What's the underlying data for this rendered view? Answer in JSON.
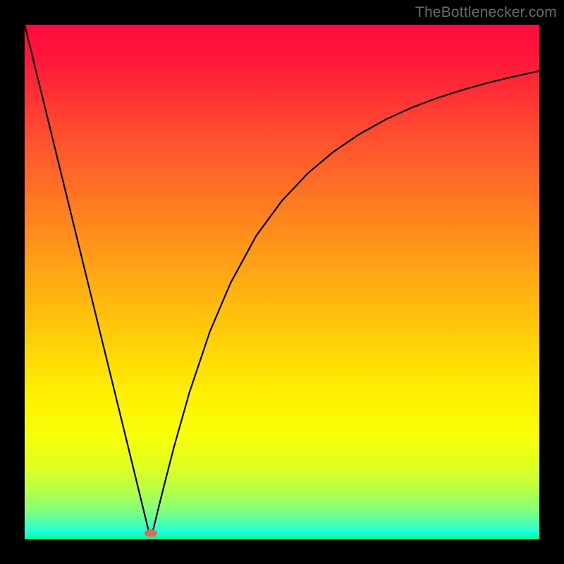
{
  "watermark": "TheBottlenecker.com",
  "chart_data": {
    "type": "line",
    "title": "",
    "xlabel": "",
    "ylabel": "",
    "xlim": [
      0,
      100
    ],
    "ylim": [
      0,
      100
    ],
    "grid": false,
    "background_gradient": {
      "stops": [
        {
          "offset": 0.0,
          "color": "#ff093e"
        },
        {
          "offset": 0.08,
          "color": "#ff1b3a"
        },
        {
          "offset": 0.2,
          "color": "#ff4930"
        },
        {
          "offset": 0.35,
          "color": "#ff7b22"
        },
        {
          "offset": 0.5,
          "color": "#ffac13"
        },
        {
          "offset": 0.62,
          "color": "#ffd208"
        },
        {
          "offset": 0.72,
          "color": "#fff000"
        },
        {
          "offset": 0.8,
          "color": "#f8ff08"
        },
        {
          "offset": 0.86,
          "color": "#deff22"
        },
        {
          "offset": 0.905,
          "color": "#b6ff48"
        },
        {
          "offset": 0.94,
          "color": "#87ff78"
        },
        {
          "offset": 0.965,
          "color": "#54ffab"
        },
        {
          "offset": 0.985,
          "color": "#20ffdf"
        },
        {
          "offset": 1.0,
          "color": "#00ff89"
        }
      ]
    },
    "marker": {
      "x": 24.5,
      "y": 1.2,
      "color": "#d66b5a"
    },
    "series": [
      {
        "name": "curve",
        "color": "#000000",
        "x": [
          0,
          5,
          10,
          15,
          20,
          22,
          23,
          24,
          24.5,
          25,
          26,
          27,
          29,
          32,
          36,
          40,
          45,
          50,
          55,
          60,
          65,
          70,
          75,
          80,
          85,
          90,
          95,
          100
        ],
        "y": [
          100,
          79.6,
          59.2,
          38.8,
          18.4,
          10.2,
          6.1,
          2.0,
          1.0,
          2.0,
          6.1,
          10.1,
          17.9,
          28.5,
          40.4,
          49.8,
          59.0,
          65.8,
          71.1,
          75.3,
          78.7,
          81.5,
          83.8,
          85.7,
          87.3,
          88.7,
          89.9,
          91.0
        ]
      }
    ]
  }
}
